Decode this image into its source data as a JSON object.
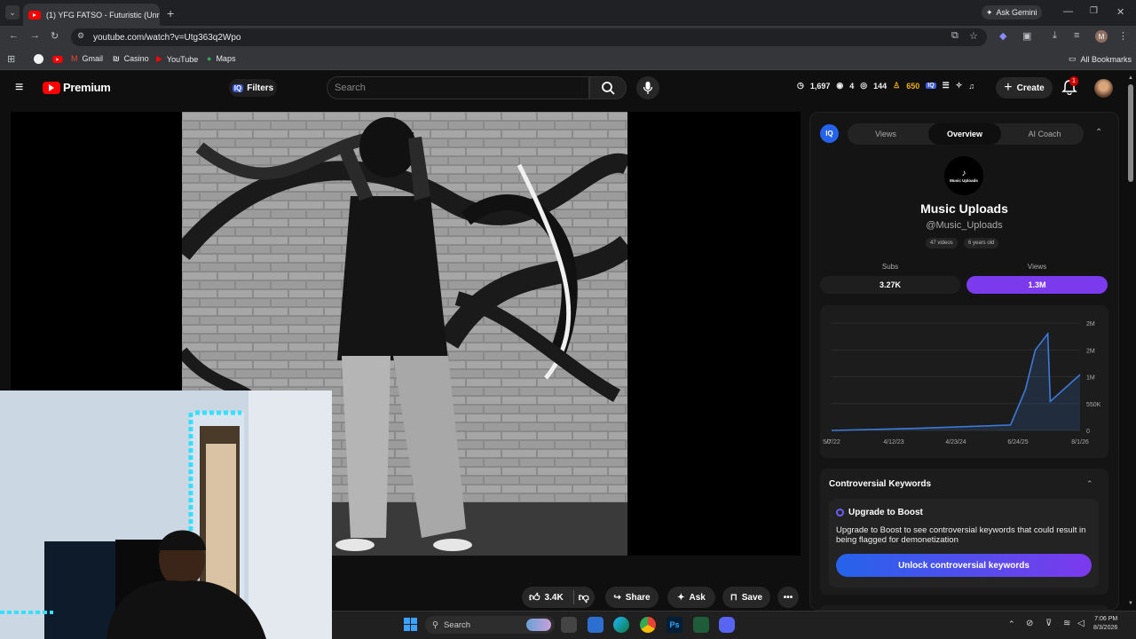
{
  "browser": {
    "tab_title": "(1) YFG FATSO - Futuristic (Unr",
    "url": "youtube.com/watch?v=Utg363q2Wpo",
    "ask_gemini": "Ask Gemini",
    "profile_initial": "M"
  },
  "bookmarks": {
    "items": [
      "Gmail",
      "Casino",
      "YouTube",
      "Maps"
    ],
    "all": "All Bookmarks"
  },
  "youtube": {
    "brand": "Premium",
    "filters": "Filters",
    "search_placeholder": "Search",
    "create": "Create",
    "notif_count": "1"
  },
  "stats": {
    "s1": "1,697",
    "s2": "4",
    "s3": "144",
    "s4": "650"
  },
  "video_actions": {
    "likes": "3.4K",
    "share": "Share",
    "ask": "Ask",
    "save": "Save"
  },
  "panel": {
    "badge": "IQ",
    "tabs": [
      "Views",
      "Overview",
      "AI Coach"
    ],
    "channel_avatar": "Music Uploads",
    "channel_name": "Music Uploads",
    "channel_handle": "@Music_Uploads",
    "videos": "47 videos",
    "age": "6 years old",
    "subs_label": "Subs",
    "views_label": "Views",
    "subs_value": "3.27K",
    "views_value": "1.3M",
    "controversial_title": "Controversial Keywords",
    "upgrade_title": "Upgrade to Boost",
    "upgrade_text": "Upgrade to Boost to see controversial keywords that could result in being flagged for demonetization",
    "unlock_button": "Unlock controversial keywords"
  },
  "chart_data": {
    "type": "line",
    "x": [
      "5/7/22",
      "4/12/23",
      "4/23/24",
      "6/24/25",
      "8/1/26"
    ],
    "yticks": [
      "2M",
      "2M",
      "1M",
      "550K",
      "0"
    ],
    "series": [
      {
        "values": [
          {
            "x": 0,
            "y": 0
          },
          {
            "x": 0.35,
            "y": 0.02
          },
          {
            "x": 0.72,
            "y": 0.05
          },
          {
            "x": 0.78,
            "y": 0.38
          },
          {
            "x": 0.82,
            "y": 0.75
          },
          {
            "x": 0.87,
            "y": 0.9
          },
          {
            "x": 0.88,
            "y": 0.27
          },
          {
            "x": 1.0,
            "y": 0.52
          }
        ]
      }
    ],
    "color": "#3d7bd9"
  },
  "taskbar": {
    "search": "Search",
    "time": "7:06 PM",
    "date": "8/3/2026"
  }
}
